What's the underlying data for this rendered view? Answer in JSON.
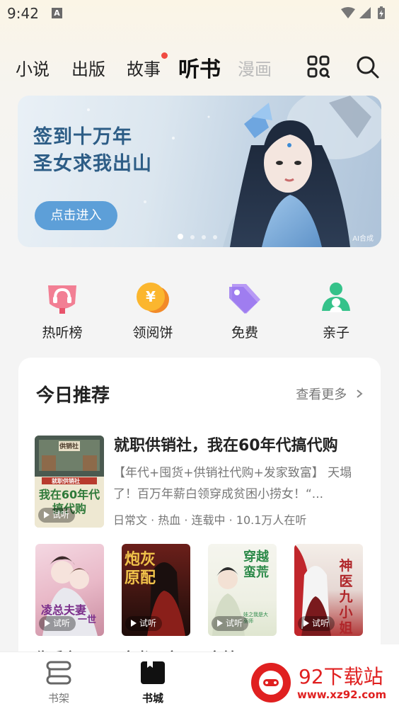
{
  "status_bar": {
    "time": "9:42",
    "badge": "A"
  },
  "top_tabs": [
    {
      "label": "小说",
      "active": false
    },
    {
      "label": "出版",
      "active": false
    },
    {
      "label": "故事",
      "active": false,
      "dot": true
    },
    {
      "label": "听书",
      "active": true
    },
    {
      "label": "漫画",
      "active": false
    }
  ],
  "banner": {
    "title_line1": "签到十万年",
    "title_line2": "圣女求我出山",
    "button": "点击进入",
    "ai_tag": "AI合成"
  },
  "categories": [
    {
      "label": "热听榜",
      "icon": "headphones-trophy-icon",
      "color": "#f0617a"
    },
    {
      "label": "领阅饼",
      "icon": "yen-coin-icon",
      "color": "#f6a01a"
    },
    {
      "label": "免费",
      "icon": "price-tag-icon",
      "color": "#9b7bf0"
    },
    {
      "label": "亲子",
      "icon": "parent-child-icon",
      "color": "#35c28a"
    }
  ],
  "recommend": {
    "title": "今日推荐",
    "more": "查看更多",
    "featured": {
      "title": "就职供销社，我在60年代搞代购",
      "desc": "【年代+囤货+供销社代购+发家致富】 天塌了！百万年薪白领穿成贫困小捞女！“...",
      "meta": "日常文 · 热血 · 连载中 · 10.1万人在听",
      "cover_text": "我在60年代搞代购",
      "cover_sign": "供销社",
      "cover_tag": "就职供销社",
      "cover_play": "试听"
    },
    "books": [
      {
        "title": "缘后之",
        "cover_text": "凌总夫妻",
        "cover_sub": "一世",
        "play": "试听"
      },
      {
        "title": "宠书 · 宠",
        "cover_text": "炮灰原配",
        "play": "试听"
      },
      {
        "title": "穿越",
        "cover_text": "穿越蛮荒",
        "cover_sub": "娃之我是大巫师",
        "play": "试听"
      },
      {
        "title": "",
        "cover_text": "神医九小姐",
        "play": "试听"
      }
    ]
  },
  "bottom_nav": [
    {
      "label": "书架",
      "icon": "bookshelf-icon",
      "active": false
    },
    {
      "label": "书城",
      "icon": "book-store-icon",
      "active": true
    }
  ],
  "watermark": {
    "text": "92下载站",
    "url": "www.xz92.com"
  }
}
